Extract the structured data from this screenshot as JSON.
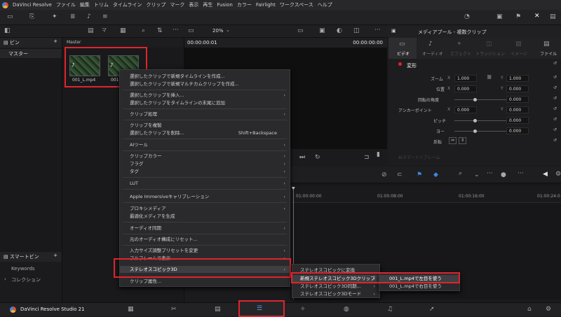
{
  "menubar": {
    "items": [
      "DaVinci Resolve",
      "ファイル",
      "編集",
      "トリム",
      "タイムライン",
      "クリップ",
      "マーク",
      "表示",
      "再生",
      "Fusion",
      "カラー",
      "Fairlight",
      "ワークスペース",
      "ヘルプ"
    ]
  },
  "toolbar": {
    "zoom": "20%"
  },
  "left_panel": {
    "bins_label": "ビン",
    "master": "マスター",
    "smart_bins": "スマートビン",
    "keywords": "Keywords",
    "collections": "コレクション"
  },
  "media": {
    "header": "Master",
    "clips": [
      {
        "name": "001_L.mp4"
      },
      {
        "name": "001"
      }
    ]
  },
  "viewer": {
    "tc_left": "00:00:00:01",
    "tc_right": "00:00:00:00"
  },
  "inspector": {
    "title": "メディアプール - 複数クリップ",
    "tabs": [
      "ビデオ",
      "オーディオ",
      "エフェクト",
      "トランジション",
      "イメージ",
      "ファイル"
    ],
    "section": "変形",
    "zoom_label": "ズーム",
    "zoom_x": "1.000",
    "zoom_y": "1.000",
    "pos_label": "位置",
    "pos_x": "0.000",
    "pos_y": "0.000",
    "rot_label": "回転の角度",
    "rot": "0.000",
    "anchor_label": "アンカーポイント",
    "anchor_x": "0.000",
    "anchor_y": "0.000",
    "pitch_label": "ピッチ",
    "pitch": "0.000",
    "yaw_label": "ヨー",
    "yaw": "0.000",
    "flip_label": "反転",
    "smart_reframe": "AIスマートリフレーム"
  },
  "timeline": {
    "ticks": [
      "01:00:00:00",
      "01:00:08:00",
      "01:00:16:00",
      "01:00:24:0"
    ]
  },
  "context_menu": {
    "items": [
      {
        "label": "選択したクリップで新規タイムラインを作成..."
      },
      {
        "label": "選択したクリップで新規マルチカムクリップを作成..."
      },
      {
        "label": "選択したクリップを挿入...",
        "arrow": "›"
      },
      {
        "label": "選択したクリップをタイムラインの末尾に追加"
      },
      {
        "label": "クリップ処理",
        "arrow": "›"
      },
      {
        "label": "クリップを複製"
      },
      {
        "label": "選択したクリップを削除...",
        "shortcut": "Shift+Backspace"
      },
      {
        "label": "AIツール",
        "arrow": "›"
      },
      {
        "label": "クリップカラー",
        "arrow": "›"
      },
      {
        "label": "フラグ",
        "arrow": "›"
      },
      {
        "label": "タグ",
        "arrow": "›"
      },
      {
        "label": "LUT",
        "arrow": "›"
      },
      {
        "label": "Apple Immersiveキャリブレーション",
        "arrow": "›"
      },
      {
        "label": "プロキシメディア",
        "arrow": "›"
      },
      {
        "label": "最適化メディアを生成"
      },
      {
        "label": "オーディオ同期",
        "arrow": "›"
      },
      {
        "label": "元のオーディオ構成にリセット..."
      },
      {
        "label": "入力サイズ調整プリセットを変更",
        "arrow": "›"
      },
      {
        "label": "フルフレームで表示",
        "arrow": "›"
      },
      {
        "label": "ステレオスコピック3D",
        "arrow": "›"
      },
      {
        "label": "クリップ属性..."
      }
    ]
  },
  "submenu1": {
    "items": [
      {
        "label": "ステレオスコピックに変換"
      },
      {
        "label": "新規ステレオスコピック3Dクリップ",
        "arrow": "›"
      },
      {
        "label": "ステレオスコピック3D同期...",
        "arrow": "›"
      },
      {
        "label": "ステレオスコピック3Dモード",
        "arrow": "›"
      }
    ]
  },
  "submenu2": {
    "items": [
      {
        "label": "001_L.mp4で左目を使う"
      },
      {
        "label": "001_L.mp4で右目を使う"
      }
    ]
  },
  "bottombar": {
    "app": "DaVinci Resolve Studio 21"
  }
}
